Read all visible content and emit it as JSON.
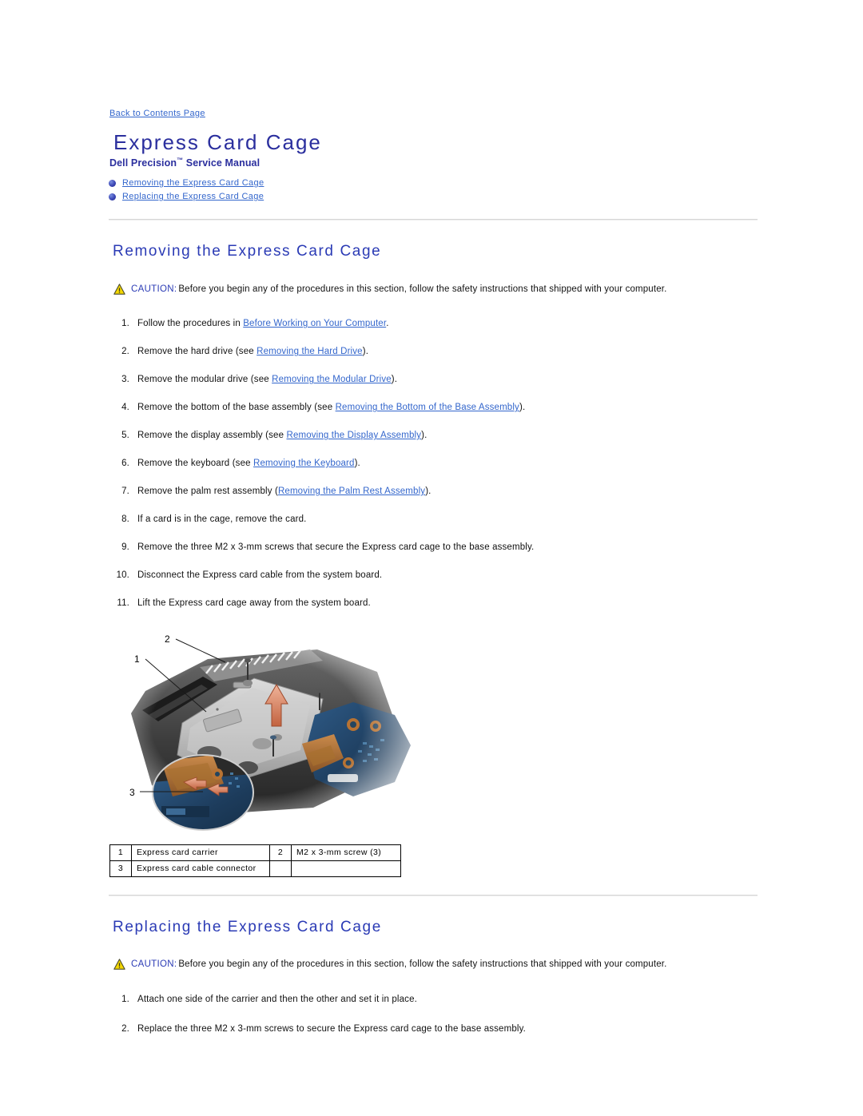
{
  "nav": {
    "back_link": "Back to Contents Page"
  },
  "header": {
    "title": "Express Card Cage",
    "subtitle_brand": "Dell Precision",
    "subtitle_tm": "™",
    "subtitle_rest": " Service Manual"
  },
  "toc": {
    "items": [
      {
        "label": "Removing the Express Card Cage"
      },
      {
        "label": "Replacing the Express Card Cage"
      }
    ]
  },
  "colors": {
    "link": "#3366cc",
    "heading": "#2b3bb5",
    "title": "#2b2f9e",
    "caution_yellow": "#f5d800",
    "rule": "#d6d6d6"
  },
  "removing": {
    "heading": "Removing the Express Card Cage",
    "caution_label": "CAUTION:",
    "caution_text": "Before you begin any of the procedures in this section, follow the safety instructions that shipped with your computer.",
    "steps": [
      {
        "num": "1.",
        "pre": "Follow the procedures in ",
        "link": "Before Working on Your Computer",
        "post": "."
      },
      {
        "num": "2.",
        "pre": "Remove the hard drive (see ",
        "link": "Removing the Hard Drive",
        "post": ")."
      },
      {
        "num": "3.",
        "pre": "Remove the modular drive (see ",
        "link": "Removing the Modular Drive",
        "post": ")."
      },
      {
        "num": "4.",
        "pre": "Remove the bottom of the base assembly (see ",
        "link": "Removing the Bottom of the Base Assembly",
        "post": ")."
      },
      {
        "num": "5.",
        "pre": "Remove the display assembly (see ",
        "link": "Removing the Display Assembly",
        "post": ")."
      },
      {
        "num": "6.",
        "pre": "Remove the keyboard (see ",
        "link": "Removing the Keyboard",
        "post": ")."
      },
      {
        "num": "7.",
        "pre": "Remove the palm rest assembly (",
        "link": "Removing the Palm Rest Assembly",
        "post": ")."
      },
      {
        "num": "8.",
        "pre": "If a card is in the cage, remove the card.",
        "link": "",
        "post": ""
      },
      {
        "num": "9.",
        "pre": "Remove the three M2 x 3-mm screws that secure the Express card cage to the base assembly.",
        "link": "",
        "post": ""
      },
      {
        "num": "10.",
        "pre": "Disconnect the Express card cable from the system board.",
        "link": "",
        "post": ""
      },
      {
        "num": "11.",
        "pre": "Lift the Express card cage away from the system board.",
        "link": "",
        "post": ""
      }
    ]
  },
  "figure": {
    "callouts": [
      {
        "num": "1"
      },
      {
        "num": "2"
      },
      {
        "num": "3"
      }
    ],
    "legend_rows": [
      {
        "idx_a": "1",
        "label_a": "Express card carrier",
        "idx_b": "2",
        "label_b": "M2 x 3-mm screw (3)"
      },
      {
        "idx_a": "3",
        "label_a": "Express card cable connector",
        "idx_b": "",
        "label_b": ""
      }
    ]
  },
  "replacing": {
    "heading": "Replacing the Express Card Cage",
    "caution_label": "CAUTION:",
    "caution_text": "Before you begin any of the procedures in this section, follow the safety instructions that shipped with your computer.",
    "steps": [
      {
        "num": "1.",
        "pre": "Attach one side of the carrier and then the other and set it in place.",
        "link": "",
        "post": ""
      },
      {
        "num": "2.",
        "pre": "Replace the three M2 x 3-mm screws to secure the Express card cage to the base assembly.",
        "link": "",
        "post": ""
      }
    ]
  }
}
